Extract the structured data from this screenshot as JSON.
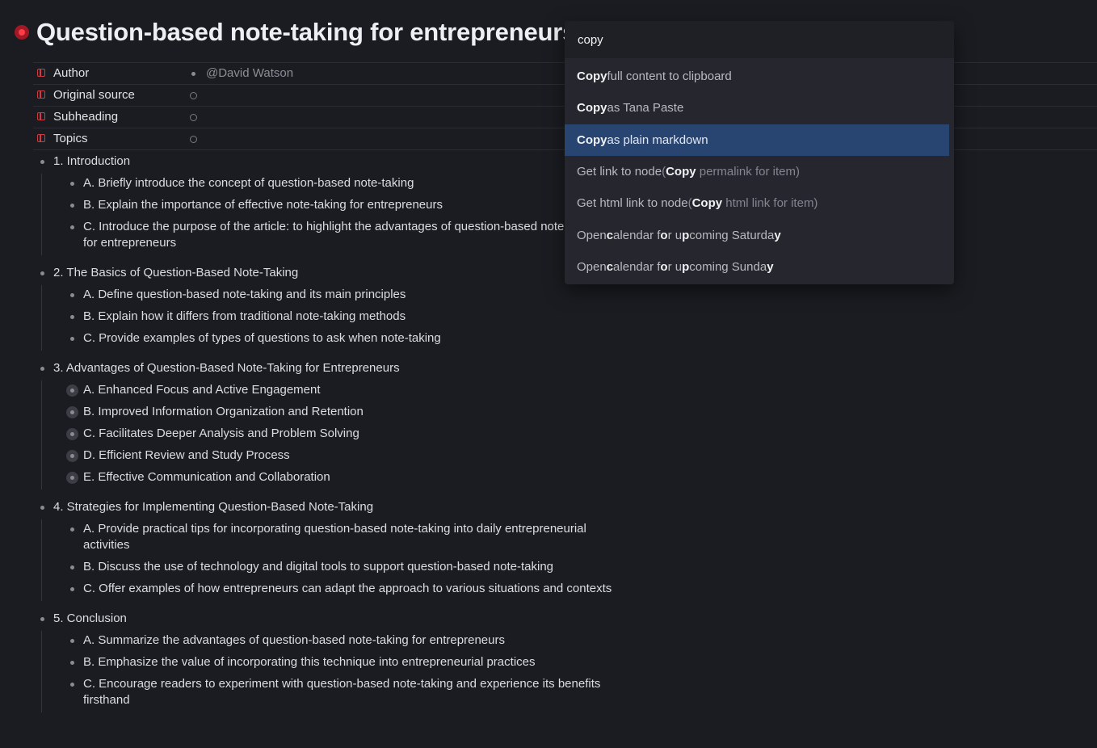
{
  "page": {
    "title": "Question-based note-taking for entrepreneurs"
  },
  "fields": [
    {
      "label": "Author",
      "value": "@David Watson"
    },
    {
      "label": "Original source",
      "value": ""
    },
    {
      "label": "Subheading",
      "value": ""
    },
    {
      "label": "Topics",
      "value": ""
    }
  ],
  "outline": [
    {
      "title": "1. Introduction",
      "children": [
        "A. Briefly introduce the concept of question-based note-taking",
        "B. Explain the importance of effective note-taking for entrepreneurs",
        "C. Introduce the purpose of the article: to highlight the advantages of question-based note-taking for entrepreneurs"
      ]
    },
    {
      "title": "2. The Basics of Question-Based Note-Taking",
      "children": [
        "A. Define question-based note-taking and its main principles",
        "B. Explain how it differs from traditional note-taking methods",
        "C. Provide examples of types of questions to ask when note-taking"
      ]
    },
    {
      "title": "3. Advantages of Question-Based Note-Taking for Entrepreneurs",
      "children": [
        "A. Enhanced Focus and Active Engagement",
        "B. Improved Information Organization and Retention",
        "C. Facilitates Deeper Analysis and Problem Solving",
        "D. Efficient Review and Study Process",
        "E. Effective Communication and Collaboration"
      ]
    },
    {
      "title": "4. Strategies for Implementing Question-Based Note-Taking",
      "children": [
        "A. Provide practical tips for incorporating question-based note-taking into daily entrepreneurial activities",
        "B. Discuss the use of technology and digital tools to support question-based note-taking",
        "C. Offer examples of how entrepreneurs can adapt the approach to various situations and contexts"
      ]
    },
    {
      "title": "5. Conclusion",
      "children": [
        "A. Summarize the advantages of question-based note-taking for entrepreneurs",
        "B. Emphasize the value of incorporating this technique into entrepreneurial practices",
        "C. Encourage readers to experiment with question-based note-taking and experience its benefits firsthand"
      ]
    }
  ],
  "palette": {
    "query": "copy",
    "commands": [
      "Copy full content to clipboard",
      "Copy as Tana Paste",
      "Copy as plain markdown",
      "Get link to node (Copy permalink for item)",
      "Get html link to node (Copy html link for item)",
      "Open calendar for upcoming Saturday",
      "Open calendar for upcoming Sunday"
    ],
    "selected_index": 2
  }
}
